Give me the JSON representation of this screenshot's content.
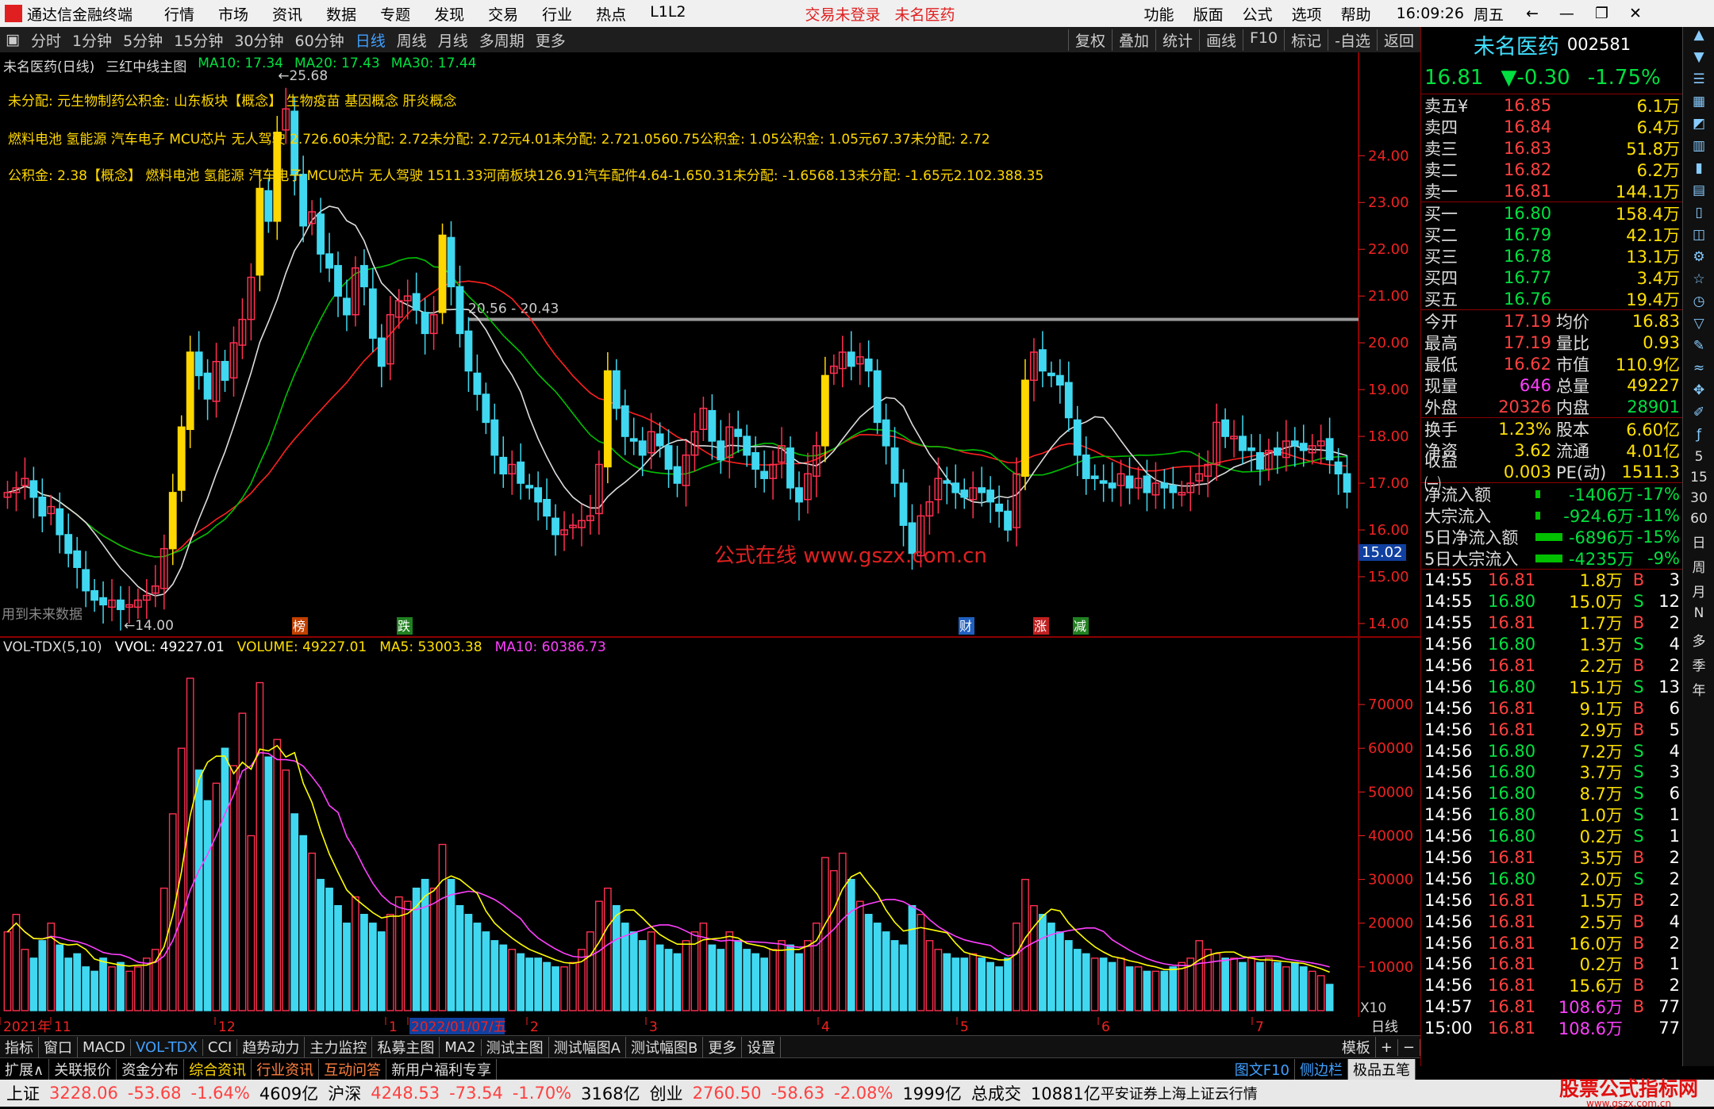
{
  "menubar": {
    "app": "通达信金融终端",
    "items": [
      "行情",
      "市场",
      "资讯",
      "数据",
      "专题",
      "发现",
      "交易",
      "行业",
      "热点",
      "L1L2"
    ],
    "center": [
      "交易未登录",
      "未名医药"
    ],
    "right": [
      "功能",
      "版面",
      "公式",
      "选项",
      "帮助"
    ],
    "time": "16:09:26",
    "weekday": "周五"
  },
  "toolbar": {
    "periods": [
      "分时",
      "1分钟",
      "5分钟",
      "15分钟",
      "30分钟",
      "60分钟",
      "日线",
      "周线",
      "月线",
      "多周期",
      "更多"
    ],
    "active": "日线",
    "right": [
      "复权",
      "叠加",
      "统计",
      "画线",
      "F10",
      "标记",
      "-自选",
      "返回"
    ]
  },
  "chart": {
    "header_name": "未名医药(日线)",
    "formula": "三红中线主图",
    "ma10": "MA10: 17.34",
    "ma20": "MA20: 17.43",
    "ma30": "MA30: 17.44",
    "info1": "未分配: 元生物制药公积金: 山东板块【概念】 生物疫苗 基因概念 肝炎概念",
    "info2": "燃料电池 氢能源 汽车电子 MCU芯片 无人驾驶 2.726.60未分配: 2.72未分配: 2.72元4.01未分配: 2.721.0560.75公积金: 1.05公积金: 1.05元67.37未分配: 2.72",
    "info3": "公积金: 2.38【概念】 燃料电池 氢能源 汽车电子 MCU芯片 无人驾驶 1511.33河南板块126.91汽车配件4.64-1.650.31未分配: -1.6568.13未分配: -1.65元2.102.388.35",
    "high_label": "25.68",
    "low_label": "14.00",
    "hline_label": "20.56 - 20.43",
    "watermark": "公式在线  www.gszx.com.cn",
    "future_note": "用到未来数据",
    "price_axis": [
      "24.00",
      "23.00",
      "22.00",
      "21.00",
      "20.00",
      "19.00",
      "18.00",
      "17.00",
      "16.00",
      "15.00",
      "14.00"
    ],
    "current_price_tag": "15.02",
    "markers": [
      {
        "t": "榜",
        "c": "#c04000"
      },
      {
        "t": "跌",
        "c": "#208020"
      },
      {
        "t": "财",
        "c": "#2060c0"
      },
      {
        "t": "涨",
        "c": "#c02020"
      },
      {
        "t": "减",
        "c": "#208020"
      }
    ],
    "vol_header": {
      "name": "VOL-TDX(5,10)",
      "vvol": "VVOL: 49227.01",
      "volume": "VOLUME: 49227.01",
      "ma5": "MA5: 53003.38",
      "ma10": "MA10: 60386.73"
    },
    "vol_axis": [
      "70000",
      "60000",
      "50000",
      "40000",
      "30000",
      "20000",
      "10000"
    ],
    "vol_unit": "X10",
    "date_axis": [
      "2021年",
      "11",
      "12",
      "1",
      "2022/01/07/五",
      "2",
      "3",
      "4",
      "5",
      "6",
      "7"
    ],
    "period_label": "日线"
  },
  "chart_data": {
    "type": "candlestick",
    "ylim": [
      14,
      25.7
    ],
    "colors": {
      "up": "#ff3050",
      "down": "#40d8f0",
      "limit_up": "#ffd700",
      "ma10": "#ffffff",
      "ma20": "#00c000",
      "ma30": "#ff2020",
      "vol_ma5": "#ffff00",
      "vol_ma10": "#ff40ff"
    },
    "close": [
      16.8,
      16.9,
      17.1,
      16.7,
      16.3,
      16.5,
      15.9,
      15.5,
      15.2,
      14.7,
      14.5,
      14.4,
      14.5,
      14.3,
      14.4,
      14.5,
      14.6,
      14.8,
      15.6,
      16.8,
      18.2,
      19.8,
      19.3,
      18.8,
      19.6,
      19.2,
      20.0,
      20.5,
      21.4,
      23.3,
      22.6,
      24.5,
      25.0,
      23.6,
      22.5,
      22.8,
      21.9,
      21.6,
      21.0,
      20.6,
      21.6,
      21.2,
      20.1,
      19.5,
      20.6,
      20.9,
      21.0,
      20.7,
      20.2,
      20.6,
      22.3,
      21.2,
      20.2,
      19.4,
      18.9,
      18.3,
      17.6,
      17.2,
      17.4,
      17.0,
      16.9,
      16.6,
      16.3,
      15.9,
      16.0,
      16.1,
      16.2,
      16.3,
      17.4,
      19.4,
      18.6,
      18.0,
      17.9,
      17.6,
      18.1,
      17.8,
      17.3,
      17.0,
      17.6,
      18.1,
      18.6,
      17.9,
      17.5,
      18.2,
      18.0,
      17.6,
      17.3,
      17.1,
      17.4,
      17.8,
      16.9,
      16.6,
      17.2,
      17.8,
      19.3,
      19.5,
      19.8,
      19.5,
      19.7,
      19.4,
      18.3,
      17.8,
      17.0,
      16.1,
      15.5,
      16.3,
      16.6,
      17.1,
      17.0,
      16.8,
      16.7,
      16.9,
      16.8,
      16.6,
      16.4,
      16.0,
      17.2,
      19.2,
      19.8,
      19.4,
      19.3,
      19.1,
      18.4,
      17.6,
      17.1,
      17.1,
      17.0,
      16.9,
      17.2,
      16.9,
      17.1,
      16.8,
      17.0,
      16.9,
      16.8,
      16.8,
      17.0,
      17.2,
      17.4,
      18.3,
      18.0,
      18.0,
      17.7,
      17.7,
      17.3,
      17.7,
      17.6,
      17.9,
      17.8,
      17.7,
      17.8,
      17.9,
      17.5,
      17.2,
      16.81
    ],
    "volume": [
      18000,
      22000,
      14000,
      12000,
      16000,
      20000,
      15000,
      12000,
      13000,
      10000,
      9000,
      12000,
      10000,
      11000,
      9000,
      10000,
      12000,
      14000,
      28000,
      45000,
      60000,
      76000,
      55000,
      48000,
      52000,
      60000,
      56000,
      68000,
      40000,
      75000,
      58000,
      62000,
      55000,
      45000,
      40000,
      36000,
      30000,
      28000,
      24000,
      20000,
      26000,
      22000,
      20000,
      18000,
      22000,
      26000,
      25000,
      28000,
      30000,
      28000,
      38000,
      30000,
      24000,
      22000,
      20000,
      18000,
      16000,
      15000,
      14000,
      13000,
      12000,
      12000,
      11000,
      10000,
      10000,
      11000,
      14000,
      18000,
      25000,
      28000,
      24000,
      20000,
      18000,
      16000,
      18000,
      15000,
      14000,
      13000,
      16000,
      18000,
      20000,
      15000,
      14000,
      18000,
      16000,
      14000,
      13000,
      12000,
      14000,
      16000,
      15000,
      13000,
      16000,
      20000,
      35000,
      32000,
      36000,
      30000,
      25000,
      22000,
      20000,
      18000,
      16000,
      15000,
      24000,
      22000,
      16000,
      14000,
      13000,
      12000,
      12000,
      13000,
      12000,
      11000,
      10000,
      12000,
      20000,
      30000,
      24000,
      22000,
      20000,
      18000,
      16000,
      14000,
      13000,
      12000,
      12000,
      11000,
      12000,
      10000,
      10000,
      9000,
      9000,
      9000,
      10000,
      11000,
      12000,
      16000,
      14000,
      13000,
      12000,
      12000,
      11000,
      12000,
      11000,
      12000,
      11000,
      10000,
      11000,
      10000,
      9000,
      8000,
      6000
    ]
  },
  "quote": {
    "name": "未名医药",
    "code": "002581",
    "price": "16.81",
    "change": "▼-0.30",
    "pct": "-1.75%",
    "asks": [
      [
        "卖五¥",
        "16.85",
        "6.1万"
      ],
      [
        "卖四",
        "16.84",
        "6.4万"
      ],
      [
        "卖三",
        "16.83",
        "51.8万"
      ],
      [
        "卖二",
        "16.82",
        "6.2万"
      ],
      [
        "卖一",
        "16.81",
        "144.1万"
      ]
    ],
    "bids": [
      [
        "买一",
        "16.80",
        "158.4万"
      ],
      [
        "买二",
        "16.79",
        "42.1万"
      ],
      [
        "买三",
        "16.78",
        "13.1万"
      ],
      [
        "买四",
        "16.77",
        "3.4万"
      ],
      [
        "买五",
        "16.76",
        "19.4万"
      ]
    ],
    "stats": [
      [
        "今开",
        "17.19",
        "均价",
        "16.83"
      ],
      [
        "最高",
        "17.19",
        "量比",
        "0.93"
      ],
      [
        "最低",
        "16.62",
        "市值",
        "110.9亿"
      ],
      [
        "现量",
        "646",
        "总量",
        "49227"
      ],
      [
        "外盘",
        "20326",
        "内盘",
        "28901"
      ]
    ],
    "stats2": [
      [
        "换手",
        "1.23%",
        "股本",
        "6.60亿"
      ],
      [
        "净资",
        "3.62",
        "流通",
        "4.01亿"
      ],
      [
        "收益㈠",
        "0.003",
        "PE(动)",
        "1511.3"
      ]
    ],
    "flows": [
      [
        "净流入额",
        "-1406万",
        "-17%"
      ],
      [
        "大宗流入",
        "-924.6万",
        "-11%"
      ],
      [
        "5日净流入额",
        "-6896万",
        "-15%"
      ],
      [
        "5日大宗流入",
        "-4235万",
        "-9%"
      ]
    ],
    "ticks": [
      [
        "14:55",
        "16.81",
        "1.8万",
        "B",
        "3"
      ],
      [
        "14:55",
        "16.80",
        "15.0万",
        "S",
        "12"
      ],
      [
        "14:55",
        "16.81",
        "1.7万",
        "B",
        "2"
      ],
      [
        "14:56",
        "16.80",
        "1.3万",
        "S",
        "4"
      ],
      [
        "14:56",
        "16.81",
        "2.2万",
        "B",
        "2"
      ],
      [
        "14:56",
        "16.80",
        "15.1万",
        "S",
        "13"
      ],
      [
        "14:56",
        "16.81",
        "9.1万",
        "B",
        "6"
      ],
      [
        "14:56",
        "16.81",
        "2.9万",
        "B",
        "5"
      ],
      [
        "14:56",
        "16.80",
        "7.2万",
        "S",
        "4"
      ],
      [
        "14:56",
        "16.80",
        "3.7万",
        "S",
        "3"
      ],
      [
        "14:56",
        "16.80",
        "8.7万",
        "S",
        "6"
      ],
      [
        "14:56",
        "16.80",
        "1.0万",
        "S",
        "1"
      ],
      [
        "14:56",
        "16.80",
        "0.2万",
        "S",
        "1"
      ],
      [
        "14:56",
        "16.81",
        "3.5万",
        "B",
        "2"
      ],
      [
        "14:56",
        "16.80",
        "2.0万",
        "S",
        "2"
      ],
      [
        "14:56",
        "16.81",
        "1.5万",
        "B",
        "2"
      ],
      [
        "14:56",
        "16.81",
        "2.5万",
        "B",
        "4"
      ],
      [
        "14:56",
        "16.81",
        "16.0万",
        "B",
        "2"
      ],
      [
        "14:56",
        "16.81",
        "0.2万",
        "B",
        "1"
      ],
      [
        "14:56",
        "16.81",
        "15.6万",
        "B",
        "2"
      ],
      [
        "14:57",
        "16.81",
        "108.6万",
        "B",
        "77"
      ],
      [
        "15:00",
        "16.81",
        "108.6万",
        "",
        "77"
      ]
    ]
  },
  "rsidebar": [
    "日",
    "周",
    "月",
    "N",
    "多",
    "季",
    "年"
  ],
  "rsidebar_nums": [
    "5",
    "15",
    "30",
    "60"
  ],
  "tabs1": [
    "指标",
    "窗口",
    "MACD",
    "VOL-TDX",
    "CCI",
    "趋势动力",
    "主力监控",
    "私募主图",
    "MA2",
    "测试主图",
    "测试幅图A",
    "测试幅图B",
    "更多",
    "设置"
  ],
  "tabs1_active": "VOL-TDX",
  "tabs1_right": "模板",
  "tabs2": [
    "扩展∧",
    "关联报价",
    "资金分布",
    "综合资讯",
    "行业资讯",
    "互动问答",
    "新用户福利专享"
  ],
  "tabs2_right": [
    "图文F10",
    "侧边栏",
    "极品五笔"
  ],
  "status": {
    "sh_label": "上证",
    "sh": "3228.06",
    "sh_chg": "-53.68",
    "sh_pct": "-1.64%",
    "sh_amt": "4609亿",
    "hs_label": "沪深",
    "hs": "4248.53",
    "hs_chg": "-73.54",
    "hs_pct": "-1.70%",
    "hs_amt": "3168亿",
    "cy_label": "创业",
    "cy": "2760.50",
    "cy_chg": "-58.63",
    "cy_pct": "-2.08%",
    "cy_amt": "1999亿",
    "total_label": "总成交",
    "total": "10881亿",
    "broker": "平安证券上海上证云行情",
    "logo": "股票公式指标网",
    "logo_url": "www.gszx.com.cn"
  }
}
